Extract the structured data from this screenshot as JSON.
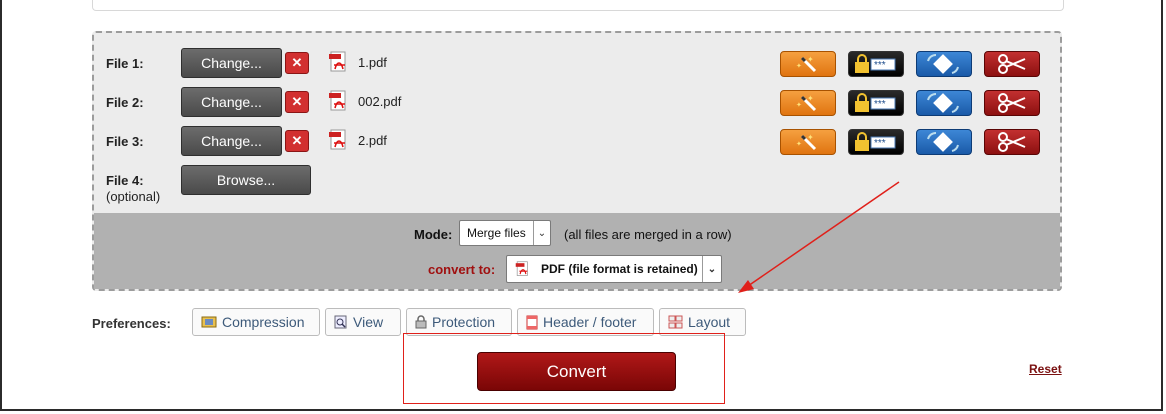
{
  "files": [
    {
      "label": "File 1:",
      "button": "Change...",
      "filename": "1.pdf"
    },
    {
      "label": "File 2:",
      "button": "Change...",
      "filename": "002.pdf"
    },
    {
      "label": "File 3:",
      "button": "Change...",
      "filename": "2.pdf"
    }
  ],
  "file4": {
    "label": "File 4:",
    "sub": "(optional)",
    "button": "Browse..."
  },
  "mode": {
    "label": "Mode:",
    "selected": "Merge files",
    "hint": "(all files are merged in a row)"
  },
  "convert_to": {
    "label": "convert to:",
    "selected": "PDF (file format is retained)"
  },
  "preferences": {
    "label": "Preferences:",
    "tabs": [
      "Compression",
      "View",
      "Protection",
      "Header / footer",
      "Layout"
    ]
  },
  "convert_button": "Convert",
  "reset_link": "Reset",
  "icons": {
    "remove": "remove-file-icon",
    "file": "pdf-file-icon",
    "tools": [
      "magic-wand-icon",
      "lock-password-icon",
      "rotate-icon",
      "scissors-icon"
    ]
  },
  "colors": {
    "accent": "#a01010",
    "convert_bg": "#8a0a0a",
    "annotation": "#e0201a"
  }
}
